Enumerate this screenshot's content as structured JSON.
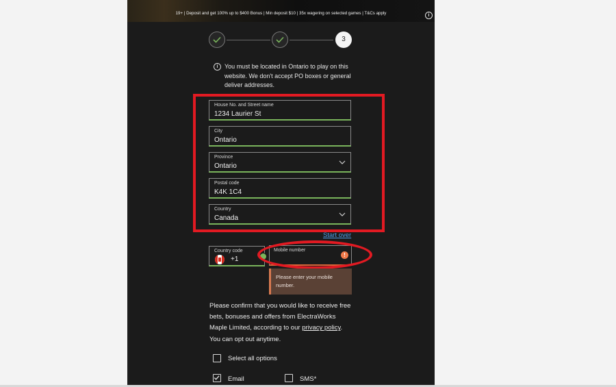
{
  "banner": {
    "text": "19+ | Deposit and get 100% up to $400 Bonus | Min deposit $10 | 35x wagering on selected games | T&Cs apply",
    "info_glyph": "i"
  },
  "stepper": {
    "steps": [
      {
        "state": "done",
        "icon": "check-icon"
      },
      {
        "state": "done",
        "icon": "check-icon"
      },
      {
        "state": "current",
        "label": "3"
      }
    ]
  },
  "notice": {
    "icon": "info-icon",
    "glyph": "i",
    "text": "You must be located in Ontario to play on this website. We don't accept PO boxes or general deliver addresses."
  },
  "address": {
    "street": {
      "label": "House No. and Street name",
      "value": "1234 Laurier St"
    },
    "city": {
      "label": "City",
      "value": "Ontario"
    },
    "province": {
      "label": "Province",
      "value": "Ontario"
    },
    "postal": {
      "label": "Postal code",
      "value": "K4K 1C4"
    },
    "country": {
      "label": "Country",
      "value": "Canada"
    }
  },
  "start_over": "Start over",
  "phone": {
    "country_code_label": "Country code",
    "country_code_value": "+1",
    "mobile_label": "Mobile number",
    "warning_glyph": "!",
    "error": "Please enter your mobile number."
  },
  "consent": {
    "text_before": "Please confirm that you would like to receive free bets, bonuses and offers from ElectraWorks Maple Limited, according to our ",
    "link": "privacy policy",
    "text_after": ". You can opt out anytime."
  },
  "options": {
    "select_all": {
      "label": "Select all options",
      "checked": false
    },
    "email": {
      "label": "Email",
      "checked": true
    },
    "sms": {
      "label": "SMS*",
      "checked": false
    }
  },
  "colors": {
    "panel_bg": "#1b1b1b",
    "accent_green": "#7ab55c",
    "annotation_red": "#e21a22",
    "error_orange": "#f07a4a",
    "link_blue": "#4f9de8"
  }
}
